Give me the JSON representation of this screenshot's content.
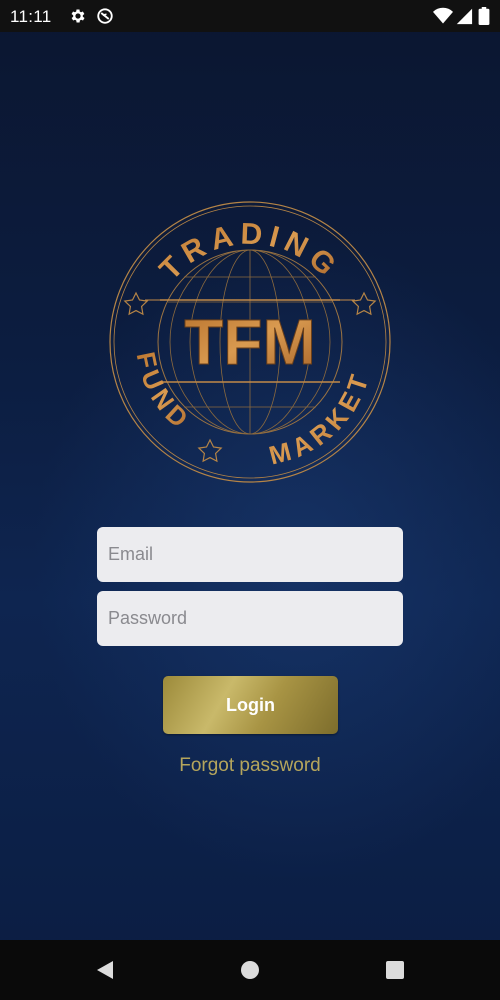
{
  "status_bar": {
    "time": "11:11",
    "icons": [
      "gear-icon",
      "do-not-disturb-icon",
      "wifi-icon",
      "signal-icon",
      "battery-icon"
    ]
  },
  "logo": {
    "top_text": "TRADING",
    "center_text": "TFM",
    "left_text": "FUND",
    "bottom_text": "MARKET",
    "accent_color": "#c8873a"
  },
  "login_form": {
    "email_placeholder": "Email",
    "password_placeholder": "Password",
    "login_label": "Login",
    "forgot_label": "Forgot password"
  },
  "nav_bar": {
    "icons": [
      "back-icon",
      "home-icon",
      "recents-icon"
    ]
  }
}
